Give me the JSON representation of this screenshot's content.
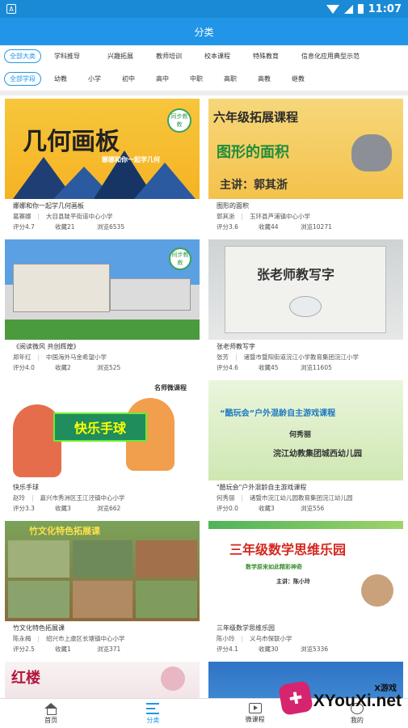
{
  "status_bar": {
    "time": "11:07"
  },
  "title": "分类",
  "filters": {
    "row1": {
      "pill": "全部大类",
      "options": [
        "学科推导",
        "兴趣拓展",
        "教师培训",
        "校本课程",
        "特殊教育",
        "信息化应用典型示范"
      ]
    },
    "row2": {
      "pill": "全部学段",
      "options": [
        "幼教",
        "小学",
        "初中",
        "高中",
        "中职",
        "高职",
        "高教",
        "继教"
      ]
    }
  },
  "cards": [
    {
      "title": "娜娜和你一起学几何画板",
      "author": "葛赛娜",
      "school": "大目县陡平街道中心小学",
      "score": "评分4.7",
      "fav": "收藏21",
      "views": "浏览6535",
      "thumb_text": "几何画板",
      "thumb_sub": "娜娜和你一起学几何",
      "badge": "同步教教"
    },
    {
      "title": "图形的面积",
      "author": "郭其浙",
      "school": "玉环县芦浦镇中心小学",
      "score": "评分3.6",
      "fav": "收藏44",
      "views": "浏览10271",
      "thumb_text": "六年级拓展课程",
      "thumb_sub": "图形的面积",
      "thumb_sub2": "主讲：郭其浙"
    },
    {
      "title": "《阅读微风 共创辉煌》",
      "author": "郑年红",
      "school": "中国海外马金希望小学",
      "score": "评分4.0",
      "fav": "收藏2",
      "views": "浏览525",
      "badge": "同步教教"
    },
    {
      "title": "张老师教写字",
      "author": "张芳",
      "school": "诸暨市暨阳街道浣江小学教育集团浣江小学",
      "score": "评分4.6",
      "fav": "收藏45",
      "views": "浏览11605",
      "thumb_text": "张老师教写字"
    },
    {
      "title": "快乐手球",
      "author": "赵玲",
      "school": "嘉兴市秀洲区王江泾镇中心小学",
      "score": "评分3.3",
      "fav": "收藏3",
      "views": "浏览662",
      "thumb_text": "快乐手球",
      "thumb_tag": "名师微课程"
    },
    {
      "title": "\"酷玩会\"户外混龄自主游戏课程",
      "author": "何秀丽",
      "school": "诸暨市浣江幼儿园教育集团浣江幼儿园",
      "score": "评分0.0",
      "fav": "收藏3",
      "views": "浏览556",
      "thumb_text": "“酷玩会”户外混龄自主游戏课程",
      "thumb_sub": "何秀丽",
      "thumb_sub2": "浣江幼教集团城西幼儿园"
    },
    {
      "title": "竹文化特色拓展课",
      "author": "陈永梅",
      "school": "绍兴市上虞区长塘镇中心小学",
      "score": "评分2.5",
      "fav": "收藏1",
      "views": "浏览371",
      "thumb_text": "竹文化特色拓展课"
    },
    {
      "title": "三年级数学思维乐园",
      "author": "陈小玲",
      "school": "义乌市保联小学",
      "score": "评分4.1",
      "fav": "收藏30",
      "views": "浏览5336",
      "thumb_text": "三年级数学思维乐园",
      "thumb_sub": "数学原来如此精彩神奇",
      "thumb_sub2": "主讲：陈小玲"
    },
    {
      "thumb_text": "红楼"
    },
    {}
  ],
  "tabs": [
    "首页",
    "分类",
    "微课程",
    "我的"
  ],
  "watermark": {
    "top": "X游戏",
    "main": "XYouXi.net"
  },
  "colors": {
    "primary": "#2196e8",
    "status": "#1a8ad6"
  }
}
